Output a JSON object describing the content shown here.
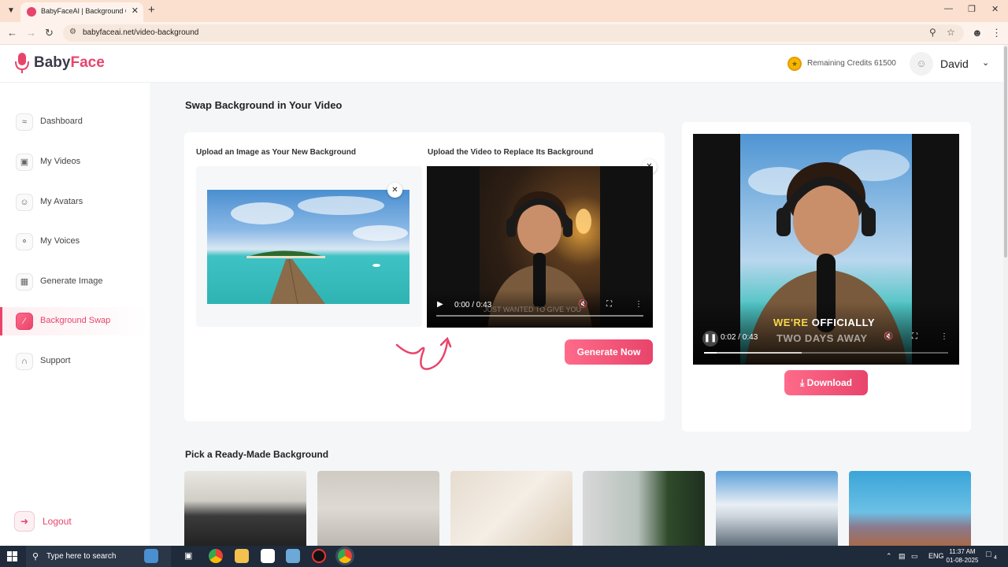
{
  "browser": {
    "tab_title": "BabyFaceAI | Background Chan...",
    "url": "babyfaceai.net/video-background",
    "icons": [
      "chevron-down-icon",
      "close-icon",
      "plus-icon",
      "back-icon",
      "forward-icon",
      "reload-icon",
      "site-info-icon",
      "zoom-icon",
      "star-icon",
      "profile-icon",
      "kebab-menu-icon"
    ]
  },
  "header": {
    "brand_part1": "Baby",
    "brand_part2": "Face",
    "credits_text": "Remaining Credits 61500",
    "user_name": "David",
    "colors": {
      "accent": "#e8446b",
      "brand_dark": "#3a3a4a"
    }
  },
  "sidebar": {
    "items": [
      {
        "label": "Dashboard",
        "icon": "chart-icon"
      },
      {
        "label": "My Videos",
        "icon": "video-icon"
      },
      {
        "label": "My Avatars",
        "icon": "user-icon"
      },
      {
        "label": "My Voices",
        "icon": "microphone-icon"
      },
      {
        "label": "Generate Image",
        "icon": "image-icon"
      },
      {
        "label": "Background Swap",
        "icon": "swap-icon",
        "active": true
      },
      {
        "label": "Support",
        "icon": "headset-icon"
      }
    ],
    "logout_label": "Logout"
  },
  "main": {
    "title": "Swap Background in Your Video",
    "upload_image_label": "Upload an Image as Your New Background",
    "upload_video_label": "Upload the Video to Replace Its Background",
    "source_video": {
      "time": "0:00 / 0:43",
      "caption": "JUST WANTED TO GIVE YOU",
      "progress": 0.0
    },
    "generate_label": "Generate Now",
    "result_video": {
      "time": "0:02 / 0:43",
      "caption_highlight": "WE'RE",
      "caption_rest": "OFFICIALLY",
      "caption_line2": "TWO DAYS AWAY",
      "progress": 0.05,
      "buffered": 0.4
    },
    "download_label": "Download",
    "ready_made_title": "Pick a Ready-Made Background"
  },
  "taskbar": {
    "search_placeholder": "Type here to search",
    "lang": "ENG",
    "time": "11:37 AM",
    "date": "01-08-2025",
    "notification_count": "4"
  }
}
